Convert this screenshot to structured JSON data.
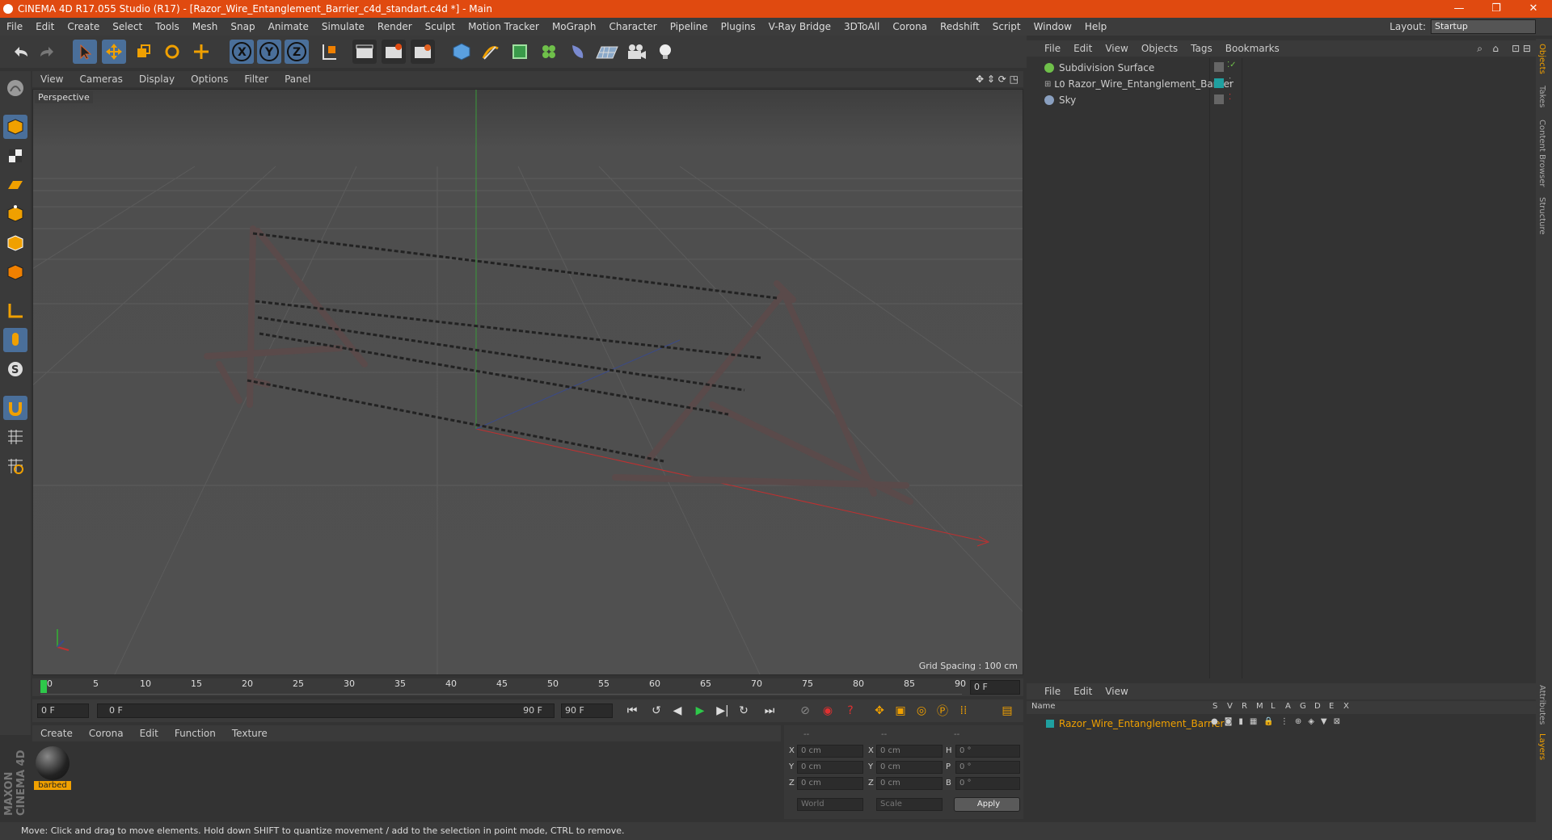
{
  "window": {
    "title": "CINEMA 4D R17.055 Studio (R17) - [Razor_Wire_Entanglement_Barrier_c4d_standart.c4d *] - Main",
    "controls": [
      "—",
      "❐",
      "✕"
    ]
  },
  "menubar": {
    "items": [
      "File",
      "Edit",
      "Create",
      "Select",
      "Tools",
      "Mesh",
      "Snap",
      "Animate",
      "Simulate",
      "Render",
      "Sculpt",
      "Motion Tracker",
      "MoGraph",
      "Character",
      "Pipeline",
      "Plugins",
      "V-Ray Bridge",
      "3DToAll",
      "Corona",
      "Redshift",
      "Script",
      "Window",
      "Help"
    ],
    "layout_label": "Layout:",
    "layout_value": "Startup"
  },
  "toolbar": {
    "icons": [
      "undo-icon",
      "redo-icon",
      "select-arrow-icon",
      "move-icon",
      "scale-icon",
      "rotate-icon",
      "live-select-icon",
      "x-axis-icon",
      "y-axis-icon",
      "z-axis-icon",
      "world-coord-icon",
      "render-view-icon",
      "render-picture-icon",
      "render-settings-icon",
      "cube-icon",
      "pen-icon",
      "subdivision-icon",
      "cloner-icon",
      "deformer-icon",
      "floor-icon",
      "camera-icon",
      "light-icon"
    ],
    "axis_labels": [
      "X",
      "Y",
      "Z"
    ]
  },
  "viewport": {
    "menu": [
      "View",
      "Cameras",
      "Display",
      "Options",
      "Filter",
      "Panel"
    ],
    "label": "Perspective",
    "grid_spacing": "Grid Spacing : 100 cm"
  },
  "timeline": {
    "ticks": [
      "0",
      "5",
      "10",
      "15",
      "20",
      "25",
      "30",
      "35",
      "40",
      "45",
      "50",
      "55",
      "60",
      "65",
      "70",
      "75",
      "80",
      "85",
      "90"
    ],
    "current_frame": "0 F",
    "start_field": "0 F",
    "range_start": "0 F",
    "range_end": "90 F",
    "end_field": "90 F"
  },
  "materials": {
    "menu": [
      "Create",
      "Corona",
      "Edit",
      "Function",
      "Texture"
    ],
    "items": [
      {
        "name": "barbed"
      }
    ]
  },
  "coords": {
    "headers": [
      "--",
      "--",
      "--"
    ],
    "rows": [
      {
        "a": "X",
        "av": "0 cm",
        "b": "X",
        "bv": "0 cm",
        "c": "H",
        "cv": "0 °"
      },
      {
        "a": "Y",
        "av": "0 cm",
        "b": "Y",
        "bv": "0 cm",
        "c": "P",
        "cv": "0 °"
      },
      {
        "a": "Z",
        "av": "0 cm",
        "b": "Z",
        "bv": "0 cm",
        "c": "B",
        "cv": "0 °"
      }
    ],
    "mode1": "World",
    "mode2": "Scale",
    "apply": "Apply"
  },
  "objects": {
    "menu": [
      "File",
      "Edit",
      "View",
      "Objects",
      "Tags",
      "Bookmarks"
    ],
    "items": [
      {
        "name": "Subdivision Surface",
        "color": "#6fc04a"
      },
      {
        "name": "Razor_Wire_Entanglement_Barrier",
        "color": "#1fa0a0"
      },
      {
        "name": "Sky",
        "color": "#8aa0c0"
      }
    ]
  },
  "layers": {
    "menu": [
      "File",
      "Edit",
      "View"
    ],
    "name_header": "Name",
    "col_headers": [
      "S",
      "V",
      "R",
      "M",
      "L",
      "A",
      "G",
      "D",
      "E",
      "X"
    ],
    "rows": [
      {
        "name": "Razor_Wire_Entanglement_Barrier",
        "color": "#1fa0a0"
      }
    ]
  },
  "side_tabs": [
    "Objects",
    "Takes",
    "Content Browser",
    "Structure"
  ],
  "side_tabs_bottom": [
    "Attributes",
    "Layers"
  ],
  "status": "Move: Click and drag to move elements. Hold down SHIFT to quantize movement / add to the selection in point mode, CTRL to remove.",
  "branding": "MAXON CINEMA 4D",
  "colors": {
    "title_bg": "#e04a10",
    "accent": "#4a6f9a",
    "material_label": "#f0a000"
  }
}
